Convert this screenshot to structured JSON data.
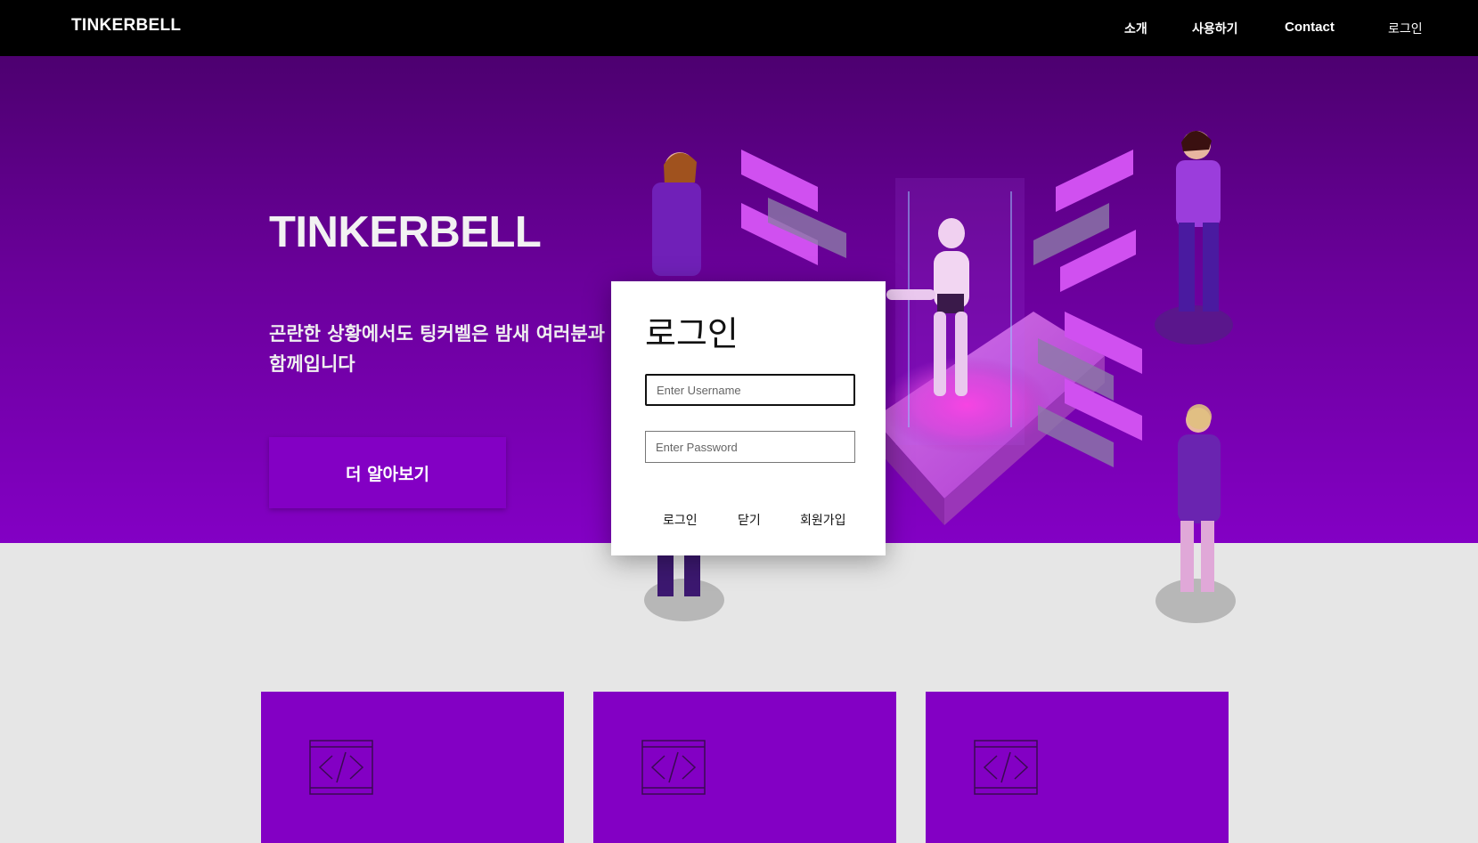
{
  "nav": {
    "brand": "TINKERBELL",
    "links": [
      "소개",
      "사용하기",
      "Contact"
    ],
    "login": "로그인"
  },
  "hero": {
    "title": "TINKERBELL",
    "subtitle": "곤란한 상황에서도 팅커벨은 밤새 여러분과 함께입니다",
    "button": "더 알아보기"
  },
  "modal": {
    "title": "로그인",
    "username_placeholder": "Enter Username",
    "password_placeholder": "Enter Password",
    "buttons": {
      "login": "로그인",
      "close": "닫기",
      "signup": "회원가입"
    }
  },
  "cards": [
    {
      "icon": "code-icon"
    },
    {
      "icon": "code-icon"
    },
    {
      "icon": "code-icon"
    }
  ],
  "colors": {
    "nav_bg": "#000000",
    "hero_top": "#4d0070",
    "hero_bottom": "#8300c4",
    "accent": "#8300c4",
    "page_bg": "#e6e6e6"
  }
}
